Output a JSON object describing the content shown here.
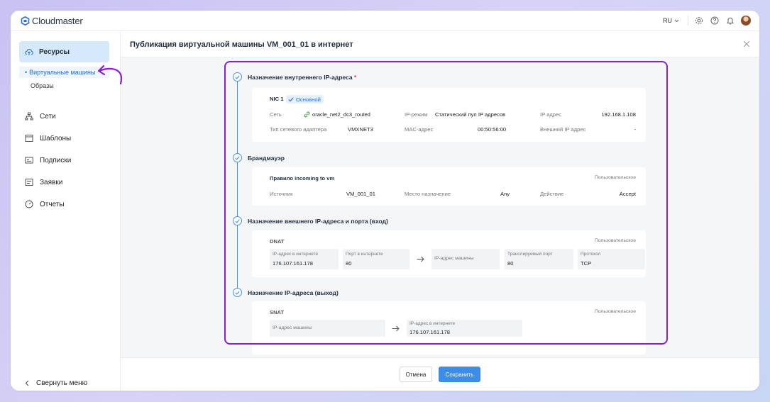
{
  "app": {
    "logo_text": "Cloudmaster"
  },
  "topbar": {
    "language": "RU"
  },
  "sidebar": {
    "resources": "Ресурсы",
    "sub_items": [
      "Виртуальные машины",
      "Образы"
    ],
    "items": [
      {
        "label": "Сети",
        "icon": "network-icon"
      },
      {
        "label": "Шаблоны",
        "icon": "template-icon"
      },
      {
        "label": "Подписки",
        "icon": "subscription-icon"
      },
      {
        "label": "Заявки",
        "icon": "requests-icon"
      },
      {
        "label": "Отчеты",
        "icon": "reports-icon"
      }
    ],
    "collapse": "Свернуть меню"
  },
  "page": {
    "title": "Публикация виртуальной машины VM_001_01 в интернет"
  },
  "sections": {
    "internal_ip": {
      "title": "Назначение внутреннего IP-адреса",
      "required_mark": "*",
      "nic": "NIC 1",
      "badge": "Основной",
      "network_label": "Сеть",
      "network_value": "oracle_net2_dc3_routed",
      "mode_label": "IP-режим",
      "mode_value": "Статический пул IP адресов",
      "ip_label": "IP адрес",
      "ip_value": "192.168.1.108",
      "adapter_label": "Тип сетевого адаптера",
      "adapter_value": "VMXNET3",
      "mac_label": "MAC-адрес",
      "mac_value": "00:50:56:00",
      "ext_ip_label": "Внешний IP адрес",
      "ext_ip_value": "-"
    },
    "firewall": {
      "title": "Брандмауэр",
      "rule": "Правило incoming to vm",
      "type": "Пользовательское",
      "source_label": "Источник",
      "source_value": "VM_001_01",
      "dest_label": "Место назначение",
      "dest_value": "Any",
      "action_label": "Действие",
      "action_value": "Accept"
    },
    "dnat": {
      "title": "Назначение внешнего IP-адреса и порта (вход)",
      "name": "DNAT",
      "type": "Пользовательское",
      "ext_ip_label": "IP-адрес в интернете",
      "ext_ip_value": "176.107.161.178",
      "ext_port_label": "Порт в интернете",
      "ext_port_value": "80",
      "machine_ip_label": "IP-адрес машины",
      "trans_port_label": "Транслируемый порт",
      "trans_port_value": "80",
      "protocol_label": "Протокол",
      "protocol_value": "TCP"
    },
    "snat": {
      "title": "Назначение IP-адреса (выход)",
      "name": "SNAT",
      "type": "Пользовательское",
      "machine_ip_label": "IP-адрес машины",
      "ext_ip_label": "IP-адрес в интернете",
      "ext_ip_value": "176.107.161.178"
    }
  },
  "footer": {
    "cancel": "Отмена",
    "save": "Сохранить"
  },
  "colors": {
    "accent": "#3d8de8",
    "highlight": "#8a1ed6",
    "active_bg": "#d6e9fb"
  }
}
